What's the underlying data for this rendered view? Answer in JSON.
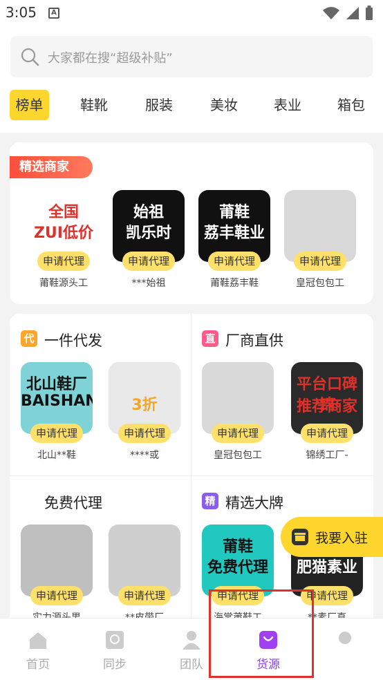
{
  "status": {
    "time": "3:05",
    "notif": "A"
  },
  "search": {
    "placeholder": "大家都在搜“超级补贴”"
  },
  "categories": [
    "榜单",
    "鞋靴",
    "服装",
    "美妆",
    "表业",
    "箱包"
  ],
  "featured": {
    "tag": "精选商家",
    "shops": [
      {
        "name": "莆鞋源头工",
        "thumb_lines": [
          "全国",
          "ZUI低价"
        ],
        "thumb_bg": "#ffffff",
        "thumb_fg": "#e0302a"
      },
      {
        "name": "***始祖",
        "thumb_lines": [
          "始祖",
          "凯乐时"
        ],
        "thumb_bg": "#111111",
        "thumb_fg": "#ffffff"
      },
      {
        "name": "莆鞋荔丰鞋",
        "thumb_lines": [
          "莆鞋",
          "荔丰鞋业"
        ],
        "thumb_bg": "#111111",
        "thumb_fg": "#ffffff"
      },
      {
        "name": "皇冠包包工",
        "thumb_lines": [
          "",
          ""
        ],
        "thumb_bg": "#d9d9d9",
        "thumb_fg": "#8a5a2b"
      }
    ]
  },
  "apply_label": "申请代理",
  "sections": [
    {
      "title": "一件代发",
      "badge": "代",
      "badge_color": "#ffa629",
      "shops": [
        {
          "name": "北山**鞋",
          "thumb_lines": [
            "北山鞋厂",
            "BAISHAN"
          ],
          "thumb_bg": "#7fd3d6",
          "thumb_fg": "#111111"
        },
        {
          "name": "****或",
          "thumb_lines": [
            "",
            "3折"
          ],
          "thumb_bg": "#e9e9e9",
          "thumb_fg": "#f5a623"
        }
      ]
    },
    {
      "title": "厂商直供",
      "badge": "直",
      "badge_color": "#ff5a8a",
      "shops": [
        {
          "name": "皇冠包包工",
          "thumb_lines": [
            "",
            ""
          ],
          "thumb_bg": "#d9d9d9",
          "thumb_fg": "#8a5a2b"
        },
        {
          "name": "锦绣工厂-",
          "thumb_lines": [
            "平台口碑推荐商家",
            "锦"
          ],
          "thumb_bg": "#2a2a2a",
          "thumb_fg": "#e0302a"
        }
      ]
    },
    {
      "title": "免费代理",
      "badge": "",
      "badge_color": "",
      "shops": [
        {
          "name": "实力源头男",
          "thumb_lines": [
            "",
            ""
          ],
          "thumb_bg": "#bfbfbf",
          "thumb_fg": "#e14a8e"
        },
        {
          "name": "**皮带厂",
          "thumb_lines": [
            "",
            ""
          ],
          "thumb_bg": "#cfcfcf",
          "thumb_fg": "#222222"
        }
      ]
    },
    {
      "title": "精选大牌",
      "badge": "精",
      "badge_color": "#8a5cf0",
      "shops": [
        {
          "name": "海棠莆鞋工",
          "thumb_lines": [
            "莆鞋",
            "免费代理"
          ],
          "thumb_bg": "#21c8c0",
          "thumb_fg": "#111111"
        },
        {
          "name": "**素厂直",
          "thumb_lines": [
            "",
            "肥猫素业"
          ],
          "thumb_bg": "#222222",
          "thumb_fg": "#ffffff"
        }
      ]
    }
  ],
  "float_button": {
    "label": "我要入驻"
  },
  "tabbar": {
    "items": [
      {
        "label": "首页",
        "icon": "home-icon",
        "color": "#cccccc"
      },
      {
        "label": "同步",
        "icon": "sync-icon",
        "color": "#cccccc"
      },
      {
        "label": "团队",
        "icon": "team-icon",
        "color": "#cccccc"
      },
      {
        "label": "货源",
        "icon": "bag-icon",
        "color": "#a040f0"
      },
      {
        "label": "",
        "icon": "profile-icon",
        "color": "#cccccc"
      }
    ],
    "active_index": 3
  }
}
